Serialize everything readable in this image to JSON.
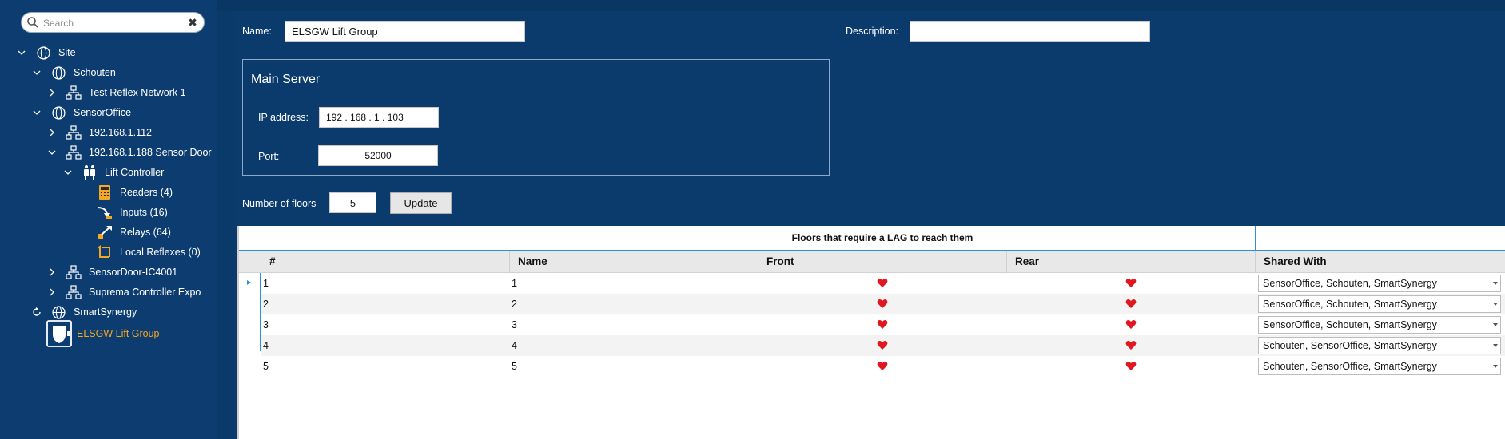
{
  "search": {
    "placeholder": "Search"
  },
  "tree": [
    {
      "label": "Site",
      "expanded": true
    },
    {
      "label": "Schouten",
      "expanded": true
    },
    {
      "label": "Test Reflex Network 1"
    },
    {
      "label": "SensorOffice",
      "expanded": true
    },
    {
      "label": "192.168.1.112"
    },
    {
      "label": "192.168.1.188 Sensor Door",
      "expanded": true
    },
    {
      "label": "Lift Controller",
      "expanded": true
    },
    {
      "label": "Readers (4)"
    },
    {
      "label": "Inputs (16)"
    },
    {
      "label": "Relays (64)"
    },
    {
      "label": "Local Reflexes (0)"
    },
    {
      "label": "SensorDoor-IC4001"
    },
    {
      "label": "Suprema Controller Expo"
    },
    {
      "label": "SmartSynergy"
    },
    {
      "label": "ELSGW Lift Group",
      "selected": true
    }
  ],
  "form": {
    "name_label": "Name:",
    "name_value": "ELSGW Lift Group",
    "description_label": "Description:",
    "description_value": "",
    "main_server_title": "Main Server",
    "ip_label": "IP address:",
    "ip_value": "192 . 168 . 1 . 103",
    "port_label": "Port:",
    "port_value": "52000",
    "floors_label": "Number of floors",
    "floors_value": "5",
    "update_label": "Update"
  },
  "grid": {
    "band_title": "Floors that require a LAG to reach them",
    "headers": [
      "#",
      "Name",
      "Front",
      "Rear",
      "Shared With"
    ],
    "rows": [
      {
        "num": "1",
        "name": "1",
        "front": true,
        "rear": true,
        "shared": "SensorOffice, Schouten, SmartSynergy"
      },
      {
        "num": "2",
        "name": "2",
        "front": true,
        "rear": true,
        "shared": "SensorOffice, Schouten, SmartSynergy"
      },
      {
        "num": "3",
        "name": "3",
        "front": true,
        "rear": true,
        "shared": "SensorOffice, Schouten, SmartSynergy"
      },
      {
        "num": "4",
        "name": "4",
        "front": true,
        "rear": true,
        "shared": "Schouten, SensorOffice, SmartSynergy"
      },
      {
        "num": "5",
        "name": "5",
        "front": true,
        "rear": true,
        "shared": "Schouten, SensorOffice, SmartSynergy"
      }
    ]
  },
  "colors": {
    "background": "#0c3a6a",
    "selected_text": "#f5a623",
    "heart": "#e0171f",
    "accent": "#2e8fd6"
  }
}
